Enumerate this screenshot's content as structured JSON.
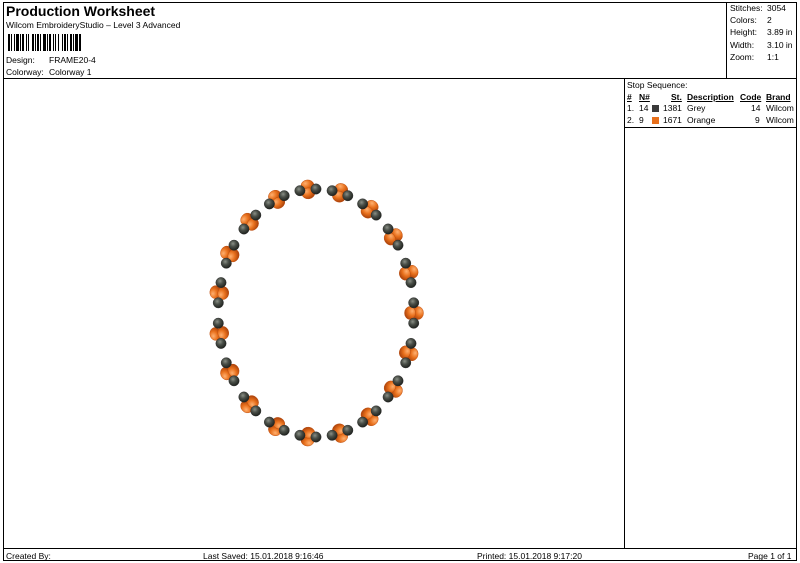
{
  "header": {
    "title": "Production Worksheet",
    "software": "Wilcom EmbroideryStudio – Level 3 Advanced",
    "design_label": "Design:",
    "design_value": "FRAME20-4",
    "colorway_label": "Colorway:",
    "colorway_value": "Colorway 1"
  },
  "stats": {
    "stitches_label": "Stitches:",
    "stitches_value": "3054",
    "colors_label": "Colors:",
    "colors_value": "2",
    "height_label": "Height:",
    "height_value": "3.89 in",
    "width_label": "Width:",
    "width_value": "3.10 in",
    "zoom_label": "Zoom:",
    "zoom_value": "1:1"
  },
  "stop_sequence": {
    "title": "Stop Sequence:",
    "columns": {
      "num": "#",
      "needle": "N#",
      "stitches": "St.",
      "description": "Description",
      "code": "Code",
      "brand": "Brand"
    },
    "rows": [
      {
        "num": "1.",
        "needle": "14",
        "color": "#3a3a3a",
        "stitches": "1381",
        "description": "Grey",
        "code": "14",
        "brand": "Wilcom"
      },
      {
        "num": "2.",
        "needle": "9",
        "color": "#e8701c",
        "stitches": "1671",
        "description": "Orange",
        "code": "9",
        "brand": "Wilcom"
      }
    ]
  },
  "footer": {
    "created_by": "Created By:",
    "last_saved": "Last Saved: 15.01.2018 9:16:46",
    "printed": "Printed: 15.01.2018 9:17:20",
    "page": "Page 1 of 1"
  },
  "design_preview": {
    "icon": "embroidery-oval-frame",
    "bead_color": "#4a4f48",
    "petal_color": "#e8701c",
    "petal_dark": "#b8480c"
  }
}
